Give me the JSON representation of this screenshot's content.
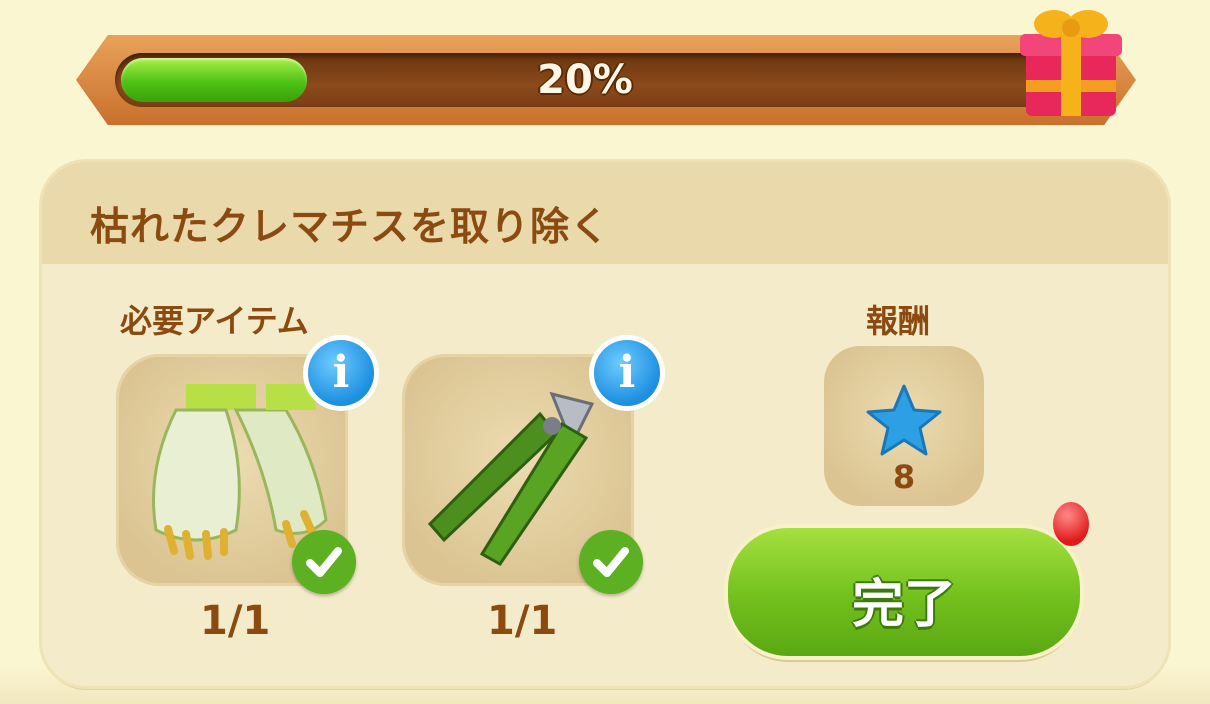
{
  "progress": {
    "value_text": "20%",
    "fraction": 0.2
  },
  "task": {
    "title": "枯れたクレマチスを取り除く",
    "required_items_label": "必要アイテム",
    "items": [
      {
        "name": "gloves",
        "count": "1/1",
        "icon": "gardening-gloves-icon"
      },
      {
        "name": "pruning-shears",
        "count": "1/1",
        "icon": "pruning-shears-icon"
      }
    ],
    "reward_label": "報酬",
    "reward": {
      "icon": "blue-star-icon",
      "amount": "8"
    },
    "complete_button_label": "完了"
  },
  "colors": {
    "accent_green": "#6cbd1c",
    "text_brown": "#8a4a10",
    "progress_green": "#4ec214"
  }
}
